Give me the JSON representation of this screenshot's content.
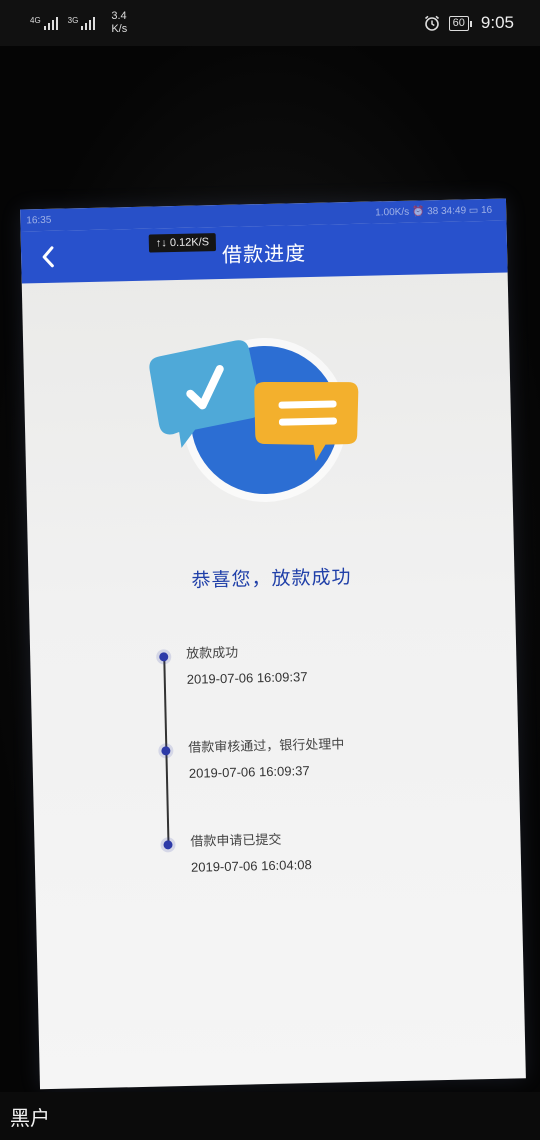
{
  "status_bar": {
    "sim1_tag": "4G",
    "sim2_tag": "3G",
    "speed_value": "3.4",
    "speed_unit": "K/s",
    "battery": "60",
    "time": "9:05"
  },
  "screen": {
    "inner_status_left": "16:35",
    "inner_status_right": "1.00K/s ⏰ 38 34:49 ▭ 16",
    "net_toast": "↑↓ 0.12K/S",
    "title": "借款进度",
    "headline": "恭喜您，放款成功",
    "timeline": [
      {
        "label": "放款成功",
        "time": "2019-07-06 16:09:37"
      },
      {
        "label": "借款审核通过，银行处理中",
        "time": "2019-07-06 16:09:37"
      },
      {
        "label": "借款申请已提交",
        "time": "2019-07-06 16:04:08"
      }
    ]
  },
  "bottom_label": "黑户",
  "colors": {
    "app_bar": "#2851cc",
    "headline": "#1f3fa8",
    "timeline_dot": "#2d3aa8",
    "circle": "#2c6ed3",
    "check_card": "#4fa9d8",
    "chat_card": "#f3b02d"
  }
}
